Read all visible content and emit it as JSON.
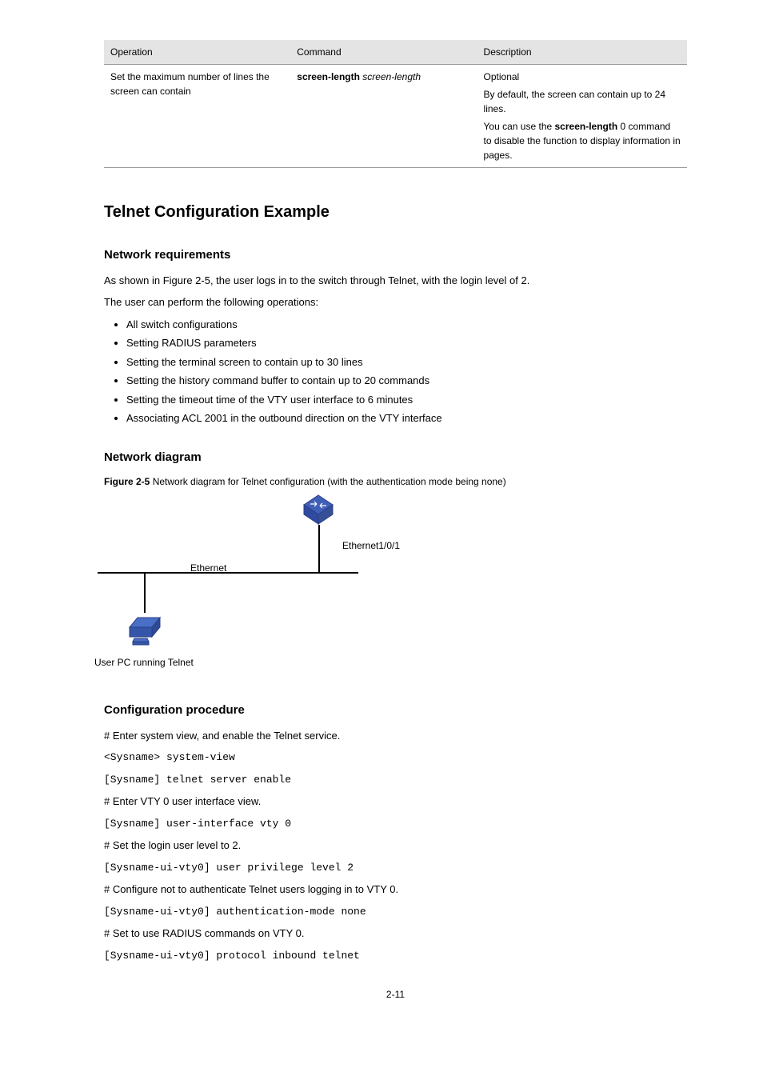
{
  "table": {
    "headers": [
      "Operation",
      "Command",
      "Description"
    ],
    "row": {
      "operation": "Set the maximum number of lines the screen can contain",
      "cmd_prefix": "screen-length",
      "cmd_arg": "screen-length",
      "desc1": "Optional",
      "desc2": "By default, the screen can contain up to 24 lines.",
      "desc3_a": "You can use the ",
      "desc3_b": "screen-length",
      "desc3_c": " 0 command to disable the function to display information in pages."
    }
  },
  "h1": "Telnet Configuration Example",
  "h2a": "Network requirements",
  "para1": "As shown in Figure 2-5, the user logs in to the switch through Telnet, with the login level of 2.",
  "para2": "The user can perform the following operations:",
  "bullets": [
    "All switch configurations",
    "Setting RADIUS parameters",
    "Setting the terminal screen to contain up to 30 lines",
    "Setting the history command buffer to contain up to 20 commands",
    "Setting the timeout time of the VTY user interface to 6 minutes",
    "Associating ACL 2001 in the outbound direction on the VTY interface"
  ],
  "h2b": "Network diagram",
  "fig_caption_label": "Figure 2-5",
  "fig_caption_text": " Network diagram for Telnet configuration (with the authentication mode being none)",
  "diagram": {
    "switch_port": "Ethernet1/0/1",
    "ethernet": "Ethernet",
    "pc_label": "User PC running Telnet"
  },
  "h2c": "Configuration procedure",
  "step1_prefix": "# Enter system view, and enable the Telnet service.",
  "step1a": "<Sysname> system-view",
  "step1b": "[Sysname] telnet server enable",
  "step2_prefix": "# Enter VTY 0 user interface view.",
  "step2a": "[Sysname] user-interface vty 0",
  "step3_prefix": "# Set the login user level to 2.",
  "step3a": "[Sysname-ui-vty0] user privilege level 2",
  "step4_prefix": "# Configure not to authenticate Telnet users logging in to VTY 0.",
  "step4a": "[Sysname-ui-vty0] authentication-mode none",
  "step5_prefix": "# Set to use RADIUS commands on VTY 0.",
  "step5a": "[Sysname-ui-vty0] protocol inbound telnet",
  "page_num": "2-11"
}
